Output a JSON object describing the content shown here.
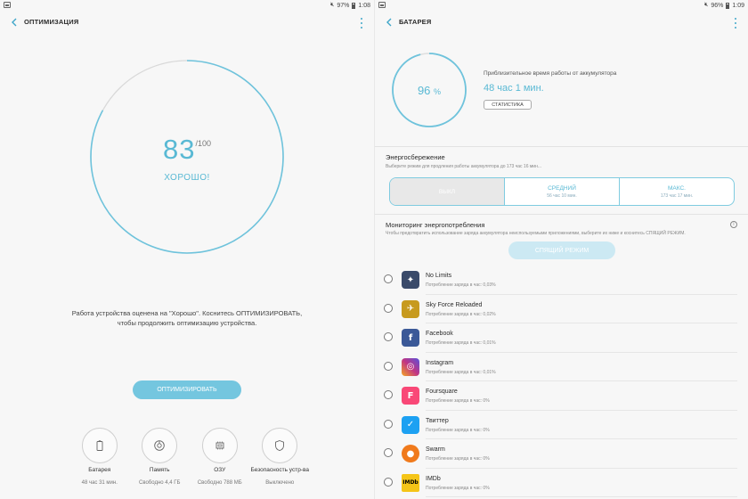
{
  "left": {
    "status": {
      "battery": "97%",
      "time": "1:08"
    },
    "title": "ОПТИМИЗАЦИЯ",
    "score": "83",
    "score_max": "/100",
    "rating": "ХОРОШО!",
    "description_line1": "Работа устройства оценена на \"Хорошо\". Коснитесь ОПТИМИЗИРОВАТЬ,",
    "description_line2": "чтобы продолжить оптимизацию устройства.",
    "optimize_label": "ОПТИМИЗИРОВАТЬ",
    "tiles": [
      {
        "label": "Батарея",
        "value": "48 час 31 мин.",
        "icon": "battery-icon"
      },
      {
        "label": "Память",
        "value": "Свободно 4,4 ГБ",
        "icon": "storage-icon"
      },
      {
        "label": "ОЗУ",
        "value": "Свободно 788 МБ",
        "icon": "ram-icon"
      },
      {
        "label": "Безопасность устр-ва",
        "value": "Выключено",
        "icon": "shield-icon"
      }
    ],
    "colors": {
      "accent": "#59b9d4",
      "button": "#74c6df"
    }
  },
  "right": {
    "status": {
      "battery": "96%",
      "time": "1:09"
    },
    "title": "БАТАРЕЯ",
    "percent": "96",
    "percent_sign": "%",
    "battery_level": 0.96,
    "estimate_label": "Приблизительное время работы от аккумулятора",
    "estimate_time": "48 час 1 мин.",
    "stats_label": "СТАТИСТИКА",
    "power_saving_title": "Энергосбережение",
    "power_saving_sub": "Выберите режим для продления работы аккумулятора до 173 час 16 мин...",
    "modes": [
      {
        "title": "ВЫКЛ",
        "sub": ""
      },
      {
        "title": "СРЕДНИЙ",
        "sub": "56 час 10 мин."
      },
      {
        "title": "МАКС.",
        "sub": "173 час 17 мин."
      }
    ],
    "monitor_title": "Мониторинг энергопотребления",
    "monitor_sub": "Чтобы предотвратить использование заряда аккумулятора неиспользуемыми приложениями, выберите их ниже и коснитесь СПЯЩИЙ РЕЖИМ.",
    "sleep_label": "СПЯЩИЙ РЕЖИМ",
    "apps": [
      {
        "name": "No Limits",
        "usage": "Потребление заряда в час: 0,03%",
        "icon": "no-limits-icon",
        "color": "#3a4a6a",
        "glyph": "✦"
      },
      {
        "name": "Sky Force Reloaded",
        "usage": "Потребление заряда в час: 0,02%",
        "icon": "sky-force-icon",
        "color": "#c79a1e",
        "glyph": "✈"
      },
      {
        "name": "Facebook",
        "usage": "Потребление заряда в час: 0,01%",
        "icon": "facebook-icon",
        "color": "#3b5998",
        "glyph": "f"
      },
      {
        "name": "Instagram",
        "usage": "Потребление заряда в час: 0,01%",
        "icon": "instagram-icon",
        "color": "#c13584",
        "glyph": "◎"
      },
      {
        "name": "Foursquare",
        "usage": "Потребление заряда в час: 0%",
        "icon": "foursquare-icon",
        "color": "#f94877",
        "glyph": "F"
      },
      {
        "name": "Твиттер",
        "usage": "Потребление заряда в час: 0%",
        "icon": "twitter-icon",
        "color": "#1da1f2",
        "glyph": "✓"
      },
      {
        "name": "Swarm",
        "usage": "Потребление заряда в час: 0%",
        "icon": "swarm-icon",
        "color": "#f07a1c",
        "glyph": "●"
      },
      {
        "name": "IMDb",
        "usage": "Потребление заряда в час: 0%",
        "icon": "imdb-icon",
        "color": "#f5c518",
        "glyph": "IMDb"
      }
    ]
  }
}
